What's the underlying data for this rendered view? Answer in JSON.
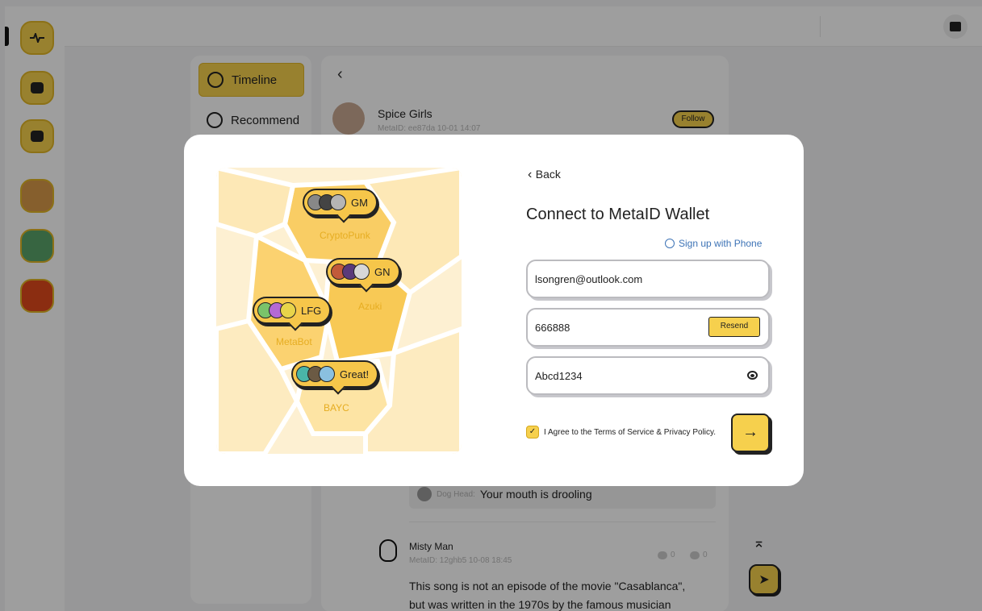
{
  "header": {
    "wallet_icon": "wallet-icon"
  },
  "rail": {
    "items": [
      "activity-icon",
      "chat-icon",
      "shop-icon",
      "avatar-robot",
      "avatar-frog",
      "avatar-flower"
    ]
  },
  "nav": {
    "timeline": "Timeline",
    "recommend": "Recommend"
  },
  "feed": {
    "post": {
      "name": "Spice Girls",
      "meta": "MetaID: ee87da 10-01 14:07",
      "follow": "Follow"
    },
    "reply": {
      "name": "Dog Head:",
      "text": "Your mouth is drooling"
    },
    "post2": {
      "name": "Misty Man",
      "meta": "MetaID: 12ghb5 10-08 18:45",
      "comments": "0",
      "likes": "0",
      "line1": "This song is not an episode of the movie \"Casablanca\",",
      "line2": "but was written in the 1970s by the famous musician"
    }
  },
  "modal": {
    "back": "Back",
    "title": "Connect to MetaID Wallet",
    "signup": "Sign up with Phone",
    "email": "lsongren@outlook.com",
    "code": "666888",
    "resend": "Resend",
    "password": "Abcd1234",
    "agree": "I Agree to the Terms of Service & Privacy Policy.",
    "submit": "→"
  },
  "illustration": {
    "bubbles": [
      "GM",
      "GN",
      "LFG",
      "Great!"
    ],
    "regions": [
      "CryptoPunk",
      "Azuki",
      "MetaBot",
      "BAYC"
    ]
  },
  "colors": {
    "accent": "#f6d04d",
    "link": "#3d73b6"
  }
}
